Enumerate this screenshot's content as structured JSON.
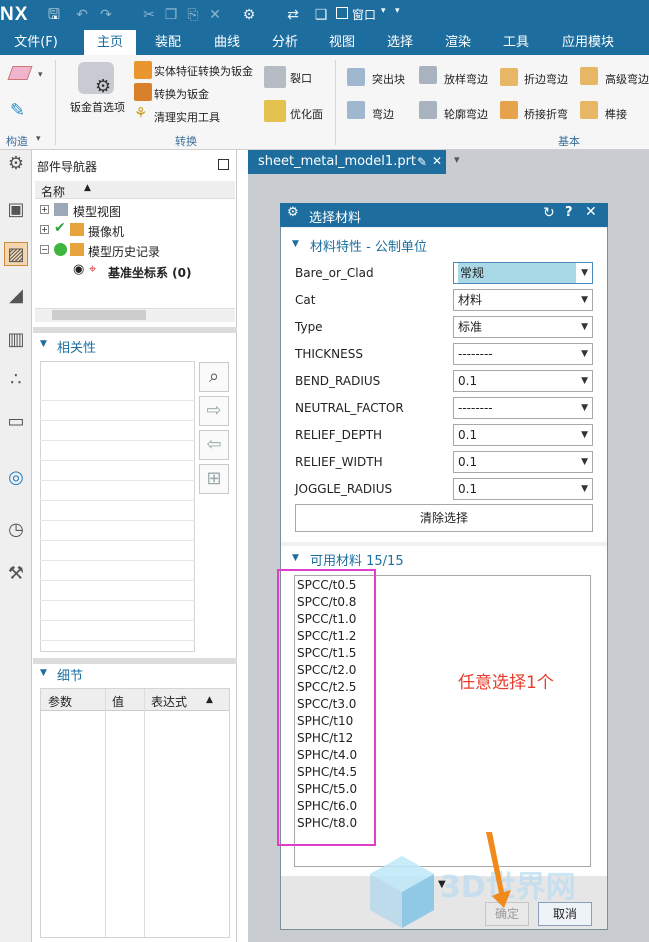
{
  "app": {
    "logo": "NX",
    "quick_access_menu": "窗口"
  },
  "menubar": [
    "文件(F)",
    "主页",
    "装配",
    "曲线",
    "分析",
    "视图",
    "选择",
    "渲染",
    "工具",
    "应用模块"
  ],
  "ribbon": {
    "group_construct": "构造",
    "sheet_metal_prefs": "钣金首选项",
    "convert_items": [
      "实体特征转换为钣金",
      "转换为钣金",
      "清理实用工具"
    ],
    "rip": "裂口",
    "optimize_face": "优化面",
    "group_convert": "转换",
    "basic_items": [
      "突出块",
      "放样弯边",
      "折边弯边",
      "高级弯边",
      "弯边",
      "轮廓弯边",
      "桥接折弯",
      "榫接"
    ],
    "group_basic": "基本"
  },
  "navigator": {
    "title": "部件导航器",
    "name_col": "名称",
    "tree": [
      "模型视图",
      "摄像机",
      "模型历史记录",
      "基准坐标系 (0)"
    ],
    "relevance_title": "相关性",
    "detail_title": "细节",
    "detail_cols": [
      "参数",
      "值",
      "表达式"
    ]
  },
  "document": {
    "tab": "sheet_metal_model1.prt"
  },
  "dialog": {
    "title": "选择材料",
    "props_section": "材料特性 - 公制单位",
    "props": [
      {
        "label": "Bare_or_Clad",
        "value": "常规"
      },
      {
        "label": "Cat",
        "value": "材料"
      },
      {
        "label": "Type",
        "value": "标准"
      },
      {
        "label": "THICKNESS",
        "value": "--------"
      },
      {
        "label": "BEND_RADIUS",
        "value": "0.1"
      },
      {
        "label": "NEUTRAL_FACTOR",
        "value": "--------"
      },
      {
        "label": "RELIEF_DEPTH",
        "value": "0.1"
      },
      {
        "label": "RELIEF_WIDTH",
        "value": "0.1"
      },
      {
        "label": "JOGGLE_RADIUS",
        "value": "0.1"
      }
    ],
    "clear_button": "清除选择",
    "available_section": "可用材料 15/15",
    "materials": [
      "SPCC/t0.5",
      "SPCC/t0.8",
      "SPCC/t1.0",
      "SPCC/t1.2",
      "SPCC/t1.5",
      "SPCC/t2.0",
      "SPCC/t2.5",
      "SPCC/t3.0",
      "SPHC/t10",
      "SPHC/t12",
      "SPHC/t4.0",
      "SPHC/t4.5",
      "SPHC/t5.0",
      "SPHC/t6.0",
      "SPHC/t8.0"
    ],
    "ok_button": "确定",
    "cancel_button": "取消"
  },
  "annotation": {
    "text": "任意选择1个",
    "highlight_color": "#e040c8",
    "text_color": "#e83c2c"
  },
  "watermark": {
    "text": "3D世界网"
  },
  "colors": {
    "accent": "#1d6e9f",
    "selected_field": "#a9d8e6"
  }
}
